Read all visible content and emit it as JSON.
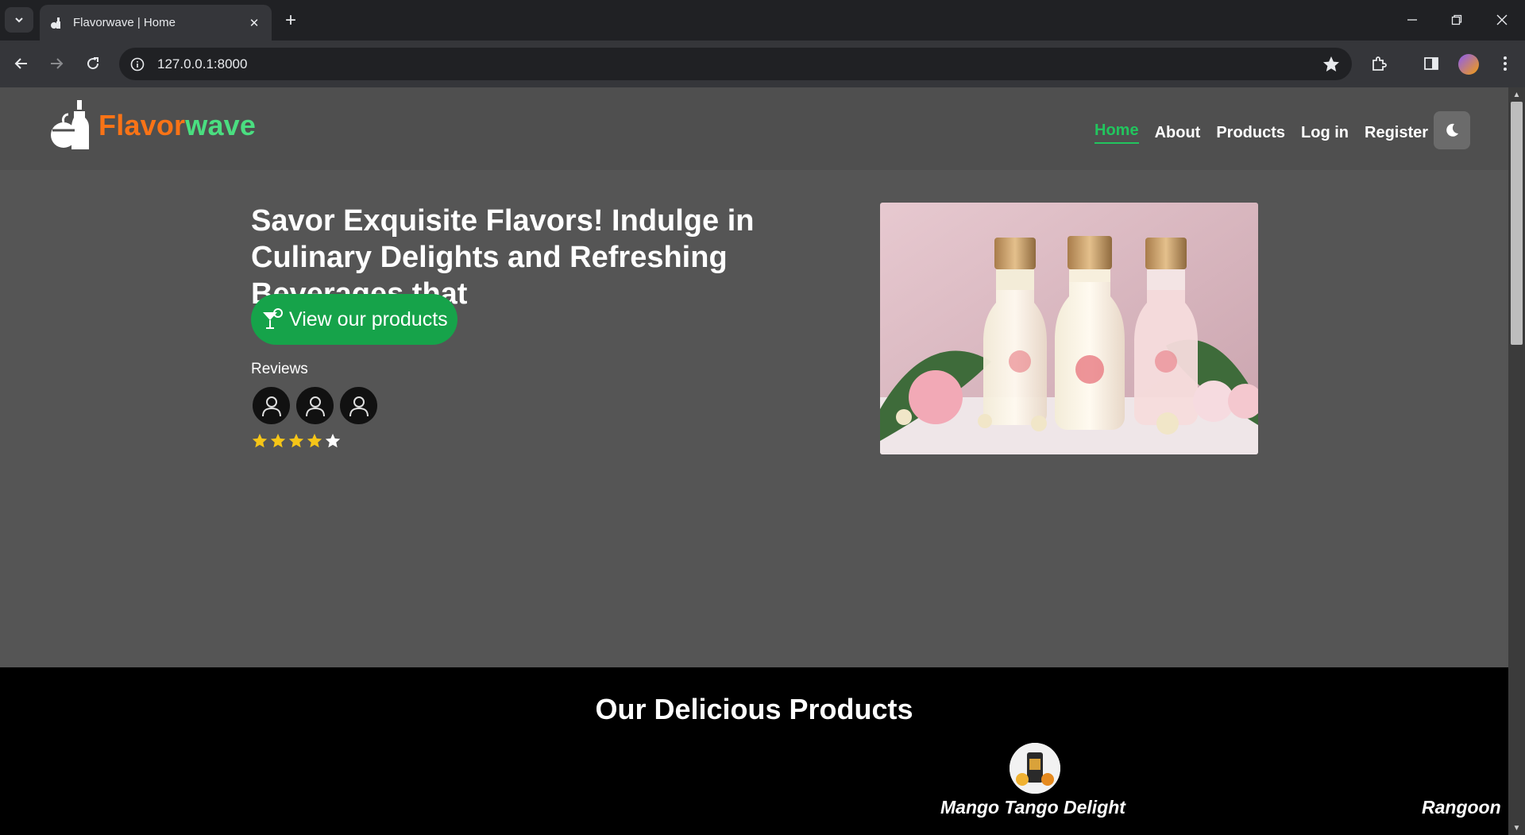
{
  "browser": {
    "tab_title": "Flavorwave | Home",
    "url": "127.0.0.1:8000"
  },
  "site": {
    "brand_part1": "Flavor",
    "brand_part2": "wave",
    "nav": [
      {
        "label": "Home",
        "active": true
      },
      {
        "label": "About"
      },
      {
        "label": "Products"
      },
      {
        "label": "Log in"
      },
      {
        "label": "Register"
      }
    ]
  },
  "hero": {
    "headline": "Savor Exquisite Flavors! Indulge in Culinary Delights and Refreshing Beverages that",
    "cta_label": "View our products",
    "reviews_label": "Reviews",
    "rating": 4,
    "rating_max": 5
  },
  "products": {
    "heading": "Our Delicious Products",
    "items": [
      {
        "name": "Mango Tango Delight"
      },
      {
        "name": "Rangoon"
      }
    ]
  },
  "colors": {
    "accent_green": "#16a34a",
    "brand_orange": "#f97316",
    "brand_green": "#4ade80",
    "star": "#f5c518"
  }
}
